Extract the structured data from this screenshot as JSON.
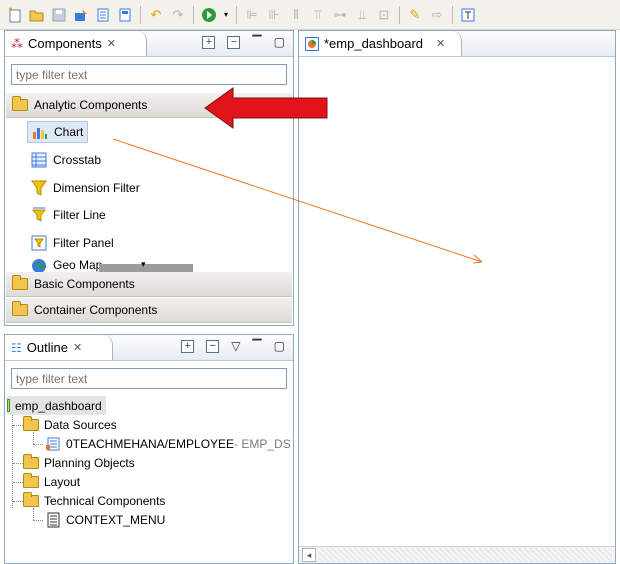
{
  "toolbar": {
    "icons": [
      "new-app-icon",
      "open-icon",
      "save-icon",
      "add-datasource-icon",
      "script-icon",
      "properties-icon",
      "undo-icon",
      "redo-icon",
      "execute-icon",
      "execute-dropdown-icon",
      "align-left-icon",
      "align-center-icon",
      "align-right-icon",
      "align-top-icon",
      "align-middle-icon",
      "align-bottom-icon",
      "fit-icon",
      "eraser-icon",
      "export-icon",
      "text-box-icon"
    ]
  },
  "components_view": {
    "title": "Components",
    "filter_placeholder": "type filter text",
    "categories": {
      "analytic": "Analytic Components",
      "basic": "Basic Components",
      "container": "Container Components"
    },
    "items": [
      {
        "label": "Chart",
        "icon": "chart-icon",
        "selected": true
      },
      {
        "label": "Crosstab",
        "icon": "crosstab-icon"
      },
      {
        "label": "Dimension Filter",
        "icon": "dimension-filter-icon"
      },
      {
        "label": "Filter Line",
        "icon": "filter-line-icon"
      },
      {
        "label": "Filter Panel",
        "icon": "filter-panel-icon"
      },
      {
        "label": "Geo Map",
        "icon": "geo-map-icon"
      }
    ]
  },
  "outline_view": {
    "title": "Outline",
    "filter_placeholder": "type filter text",
    "root": "emp_dashboard",
    "nodes": {
      "data_sources": "Data Sources",
      "datasource_name": "0TEACHMEHANA/EMPLOYEE",
      "datasource_suffix": " - EMP_DS",
      "planning": "Planning Objects",
      "layout": "Layout",
      "technical": "Technical Components",
      "context_menu": "CONTEXT_MENU"
    }
  },
  "editor": {
    "tab_label": "*emp_dashboard"
  },
  "colors": {
    "annotation_arrow": "#e0141a",
    "drag_line": "#e8772e",
    "selection": "#dde8f7"
  }
}
